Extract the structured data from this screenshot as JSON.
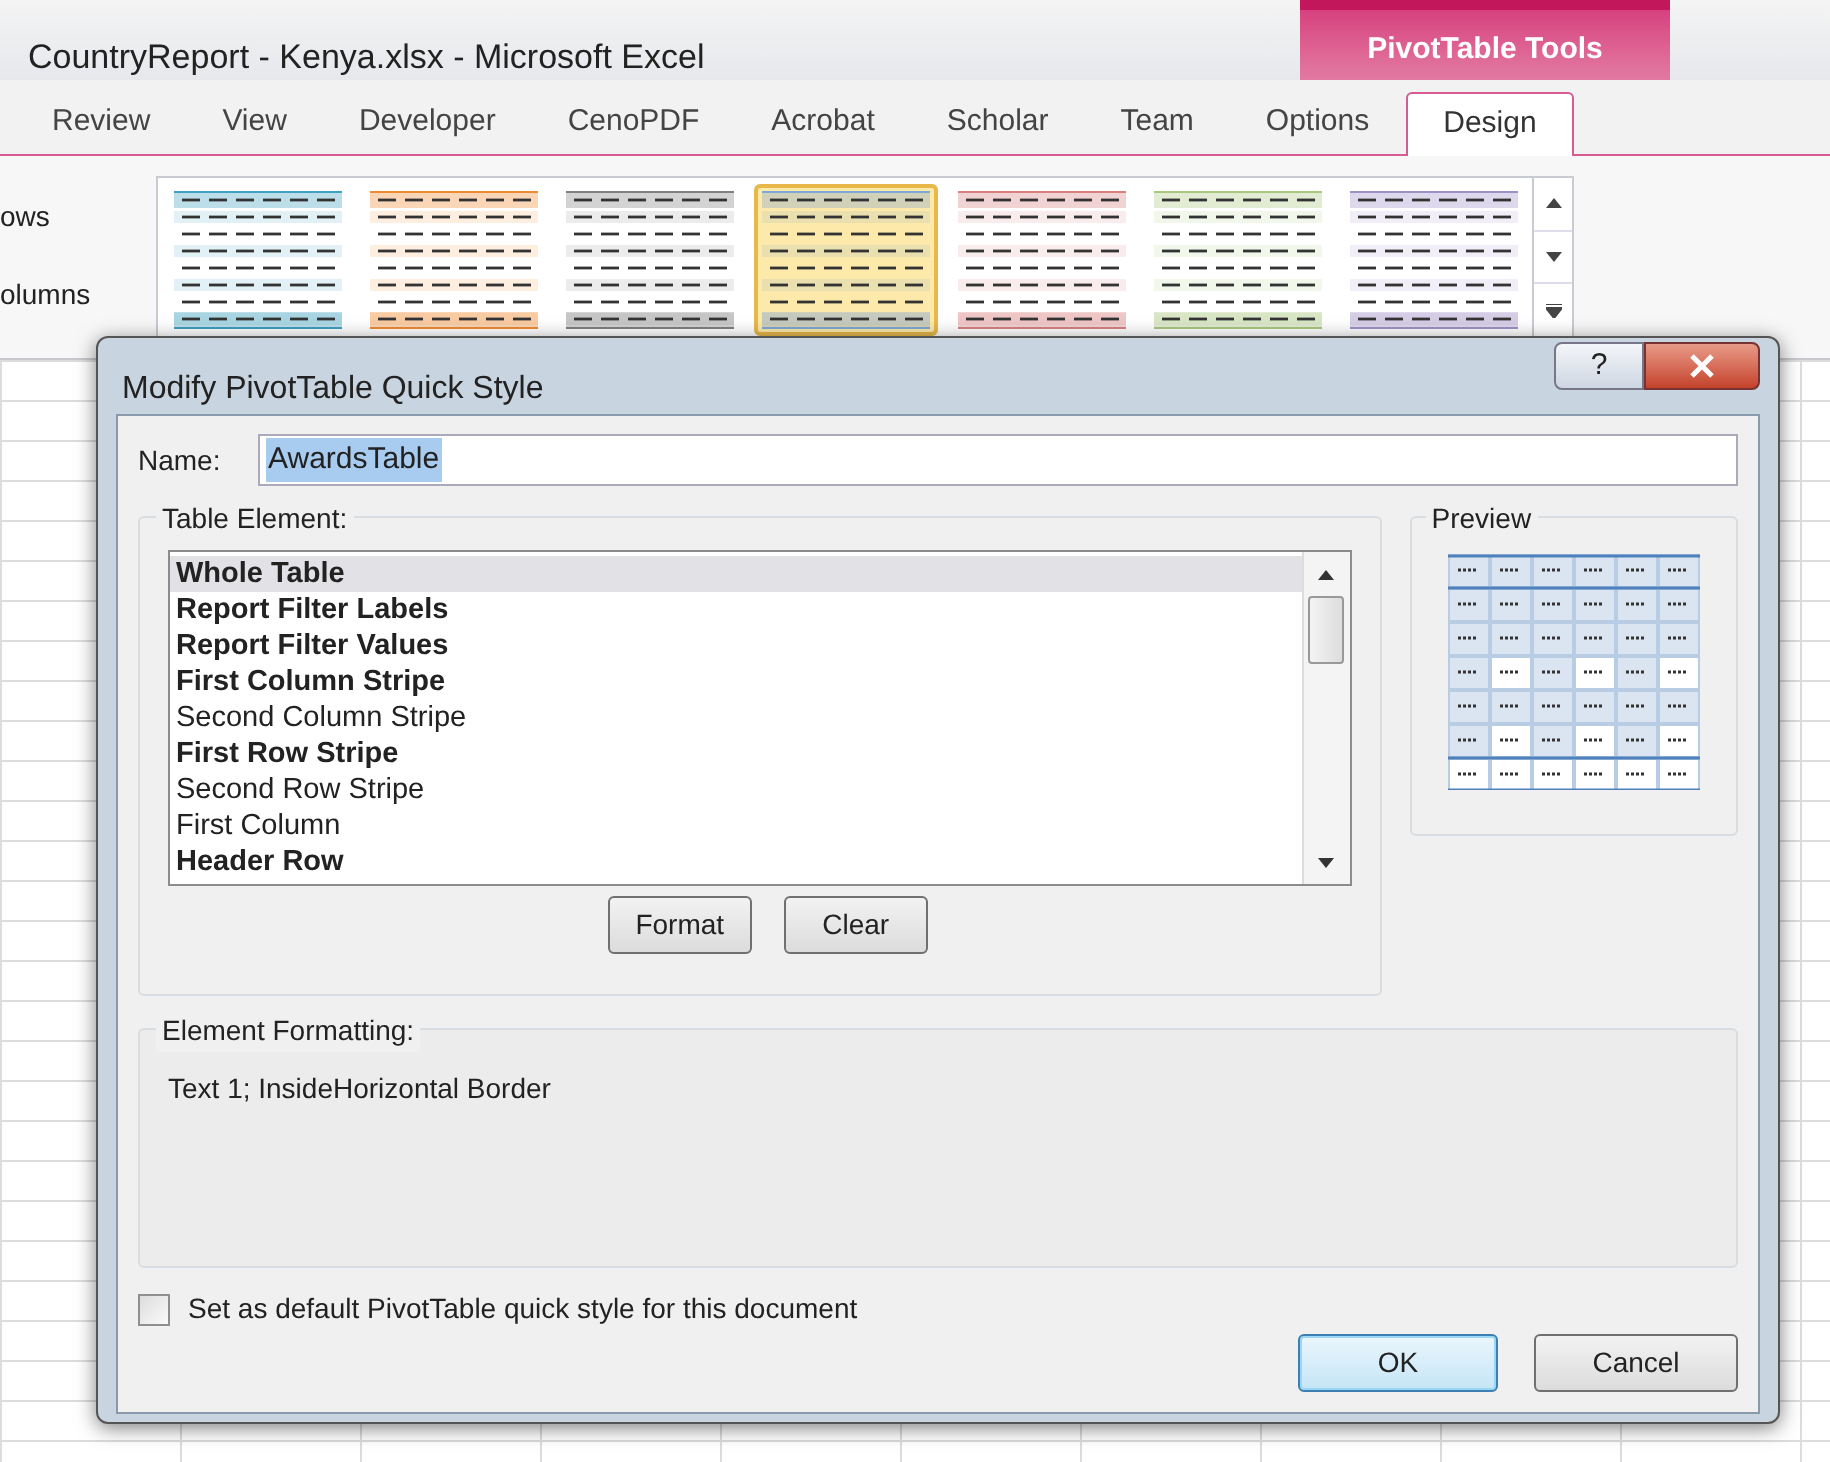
{
  "window": {
    "title": "CountryReport - Kenya.xlsx  -  Microsoft Excel",
    "context_tab_group": "PivotTable Tools"
  },
  "ribbon_tabs": [
    {
      "label": "Review",
      "selected": false
    },
    {
      "label": "View",
      "selected": false
    },
    {
      "label": "Developer",
      "selected": false
    },
    {
      "label": "CenoPDF",
      "selected": false
    },
    {
      "label": "Acrobat",
      "selected": false
    },
    {
      "label": "Scholar",
      "selected": false
    },
    {
      "label": "Team",
      "selected": false
    },
    {
      "label": "Options",
      "selected": false
    },
    {
      "label": "Design",
      "selected": true
    }
  ],
  "ribbon_labels": [
    "ows",
    "olumns"
  ],
  "style_gallery": [
    {
      "color": "#3fa0c0",
      "selected": false
    },
    {
      "color": "#f08a30",
      "selected": false
    },
    {
      "color": "#808080",
      "selected": false
    },
    {
      "color": "#7fa7d8",
      "selected": true
    },
    {
      "color": "#d98080",
      "selected": false
    },
    {
      "color": "#a8c880",
      "selected": false
    },
    {
      "color": "#a090c8",
      "selected": false
    }
  ],
  "dialog": {
    "title": "Modify PivotTable Quick Style",
    "help_button": "?",
    "name_label": "Name:",
    "name_value": "AwardsTable",
    "table_element_label": "Table Element:",
    "table_elements": [
      {
        "label": "Whole Table",
        "bold": true,
        "selected": true
      },
      {
        "label": "Report Filter Labels",
        "bold": true,
        "selected": false
      },
      {
        "label": "Report Filter Values",
        "bold": true,
        "selected": false
      },
      {
        "label": "First Column Stripe",
        "bold": true,
        "selected": false
      },
      {
        "label": "Second Column Stripe",
        "bold": false,
        "selected": false
      },
      {
        "label": "First Row Stripe",
        "bold": true,
        "selected": false
      },
      {
        "label": "Second Row Stripe",
        "bold": false,
        "selected": false
      },
      {
        "label": "First Column",
        "bold": false,
        "selected": false
      },
      {
        "label": "Header Row",
        "bold": true,
        "selected": false
      }
    ],
    "buttons": [
      "Format",
      "Clear"
    ],
    "preview_label": "Preview",
    "element_formatting_label": "Element Formatting:",
    "element_formatting_text": "Text 1; InsideHorizontal Border",
    "default_checkbox": {
      "label": "Set as default PivotTable quick style for this document",
      "checked": false
    },
    "ok_button": "OK",
    "cancel_button": "Cancel"
  }
}
